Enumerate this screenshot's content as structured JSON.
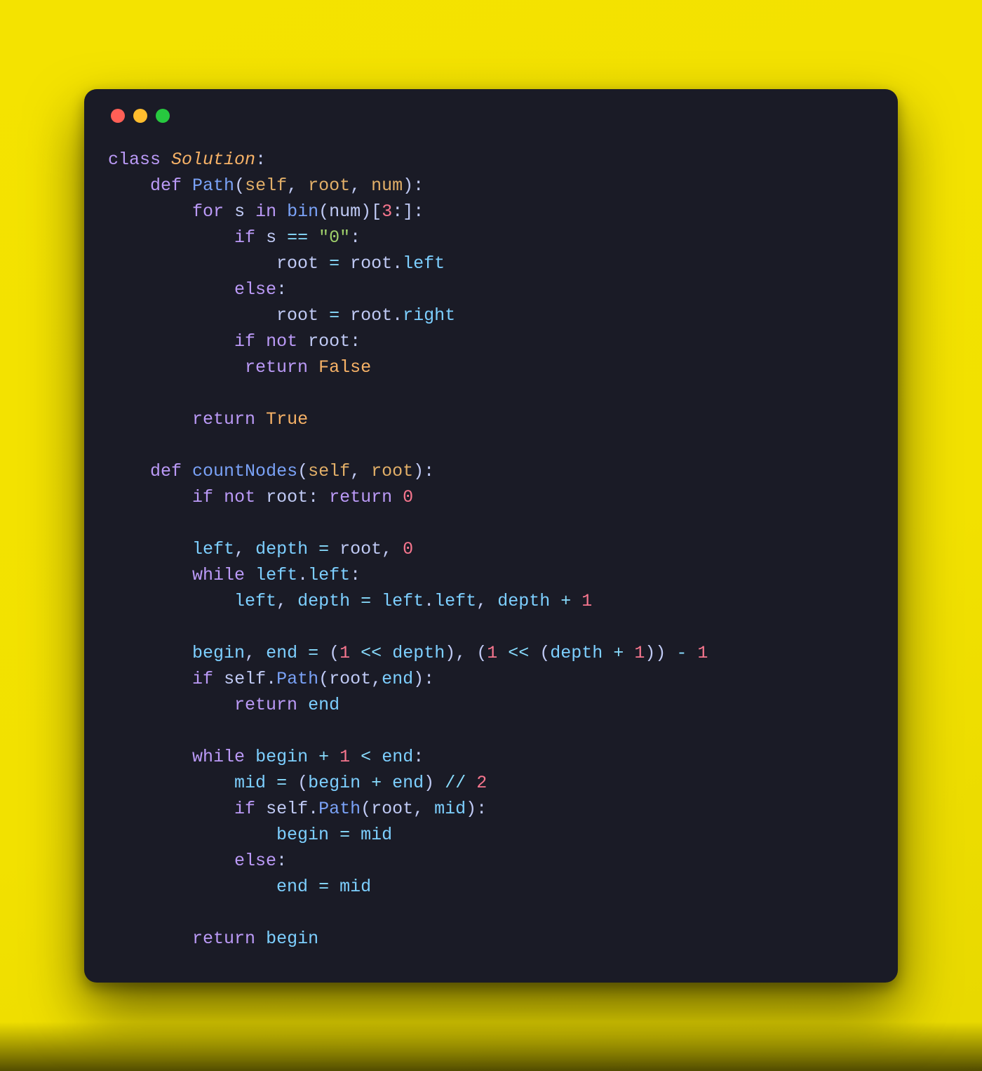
{
  "language": "python",
  "theme": {
    "background": "#1a1b26",
    "frame_background": "#f4e300",
    "keyword": "#bb9af7",
    "classname": "#f7b267",
    "function": "#7aa2f7",
    "parameter": "#e2af68",
    "identifier": "#c0caf5",
    "property": "#7dcfff",
    "number": "#f7768e",
    "string": "#9ece6a",
    "boolean": "#f7b267",
    "operator": "#89ddff"
  },
  "traffic_lights": [
    "red",
    "yellow",
    "green"
  ],
  "code_lines": [
    [
      [
        "kw",
        "class"
      ],
      [
        "pun",
        " "
      ],
      [
        "cls",
        "Solution"
      ],
      [
        "pun",
        ":"
      ]
    ],
    [
      [
        "pun",
        "    "
      ],
      [
        "kw",
        "def"
      ],
      [
        "pun",
        " "
      ],
      [
        "fn",
        "Path"
      ],
      [
        "pun",
        "("
      ],
      [
        "arg",
        "self"
      ],
      [
        "pun",
        ", "
      ],
      [
        "arg",
        "root"
      ],
      [
        "pun",
        ", "
      ],
      [
        "arg",
        "num"
      ],
      [
        "pun",
        "):"
      ]
    ],
    [
      [
        "pun",
        "        "
      ],
      [
        "kw",
        "for"
      ],
      [
        "pun",
        " "
      ],
      [
        "var",
        "s"
      ],
      [
        "pun",
        " "
      ],
      [
        "kw",
        "in"
      ],
      [
        "pun",
        " "
      ],
      [
        "fn",
        "bin"
      ],
      [
        "pun",
        "("
      ],
      [
        "var",
        "num"
      ],
      [
        "pun",
        ")["
      ],
      [
        "num",
        "3"
      ],
      [
        "pun",
        ":]:"
      ]
    ],
    [
      [
        "pun",
        "            "
      ],
      [
        "kw",
        "if"
      ],
      [
        "pun",
        " "
      ],
      [
        "var",
        "s"
      ],
      [
        "pun",
        " "
      ],
      [
        "op",
        "=="
      ],
      [
        "pun",
        " "
      ],
      [
        "str",
        "\"0\""
      ],
      [
        "pun",
        ":"
      ]
    ],
    [
      [
        "pun",
        "                "
      ],
      [
        "var",
        "root"
      ],
      [
        "pun",
        " "
      ],
      [
        "op",
        "="
      ],
      [
        "pun",
        " "
      ],
      [
        "var",
        "root"
      ],
      [
        "pun",
        "."
      ],
      [
        "prop",
        "left"
      ]
    ],
    [
      [
        "pun",
        "            "
      ],
      [
        "kw",
        "else"
      ],
      [
        "pun",
        ":"
      ]
    ],
    [
      [
        "pun",
        "                "
      ],
      [
        "var",
        "root"
      ],
      [
        "pun",
        " "
      ],
      [
        "op",
        "="
      ],
      [
        "pun",
        " "
      ],
      [
        "var",
        "root"
      ],
      [
        "pun",
        "."
      ],
      [
        "prop",
        "right"
      ]
    ],
    [
      [
        "pun",
        "            "
      ],
      [
        "kw",
        "if"
      ],
      [
        "pun",
        " "
      ],
      [
        "kw",
        "not"
      ],
      [
        "pun",
        " "
      ],
      [
        "var",
        "root"
      ],
      [
        "pun",
        ":"
      ]
    ],
    [
      [
        "pun",
        "             "
      ],
      [
        "kw",
        "return"
      ],
      [
        "pun",
        " "
      ],
      [
        "boolv",
        "False"
      ]
    ],
    [],
    [
      [
        "pun",
        "        "
      ],
      [
        "kw",
        "return"
      ],
      [
        "pun",
        " "
      ],
      [
        "boolv",
        "True"
      ]
    ],
    [],
    [
      [
        "pun",
        "    "
      ],
      [
        "kw",
        "def"
      ],
      [
        "pun",
        " "
      ],
      [
        "fn",
        "countNodes"
      ],
      [
        "pun",
        "("
      ],
      [
        "arg",
        "self"
      ],
      [
        "pun",
        ", "
      ],
      [
        "arg",
        "root"
      ],
      [
        "pun",
        "):"
      ]
    ],
    [
      [
        "pun",
        "        "
      ],
      [
        "kw",
        "if"
      ],
      [
        "pun",
        " "
      ],
      [
        "kw",
        "not"
      ],
      [
        "pun",
        " "
      ],
      [
        "var",
        "root"
      ],
      [
        "pun",
        ": "
      ],
      [
        "kw",
        "return"
      ],
      [
        "pun",
        " "
      ],
      [
        "num",
        "0"
      ]
    ],
    [],
    [
      [
        "pun",
        "        "
      ],
      [
        "prop",
        "left"
      ],
      [
        "pun",
        ", "
      ],
      [
        "prop",
        "depth"
      ],
      [
        "pun",
        " "
      ],
      [
        "op",
        "="
      ],
      [
        "pun",
        " "
      ],
      [
        "var",
        "root"
      ],
      [
        "pun",
        ", "
      ],
      [
        "num",
        "0"
      ]
    ],
    [
      [
        "pun",
        "        "
      ],
      [
        "kw",
        "while"
      ],
      [
        "pun",
        " "
      ],
      [
        "prop",
        "left"
      ],
      [
        "pun",
        "."
      ],
      [
        "prop",
        "left"
      ],
      [
        "pun",
        ":"
      ]
    ],
    [
      [
        "pun",
        "            "
      ],
      [
        "prop",
        "left"
      ],
      [
        "pun",
        ", "
      ],
      [
        "prop",
        "depth"
      ],
      [
        "pun",
        " "
      ],
      [
        "op",
        "="
      ],
      [
        "pun",
        " "
      ],
      [
        "prop",
        "left"
      ],
      [
        "pun",
        "."
      ],
      [
        "prop",
        "left"
      ],
      [
        "pun",
        ", "
      ],
      [
        "prop",
        "depth"
      ],
      [
        "pun",
        " "
      ],
      [
        "op",
        "+"
      ],
      [
        "pun",
        " "
      ],
      [
        "num",
        "1"
      ]
    ],
    [],
    [
      [
        "pun",
        "        "
      ],
      [
        "prop",
        "begin"
      ],
      [
        "pun",
        ", "
      ],
      [
        "prop",
        "end"
      ],
      [
        "pun",
        " "
      ],
      [
        "op",
        "="
      ],
      [
        "pun",
        " ("
      ],
      [
        "num",
        "1"
      ],
      [
        "pun",
        " "
      ],
      [
        "op",
        "<<"
      ],
      [
        "pun",
        " "
      ],
      [
        "prop",
        "depth"
      ],
      [
        "pun",
        "), ("
      ],
      [
        "num",
        "1"
      ],
      [
        "pun",
        " "
      ],
      [
        "op",
        "<<"
      ],
      [
        "pun",
        " ("
      ],
      [
        "prop",
        "depth"
      ],
      [
        "pun",
        " "
      ],
      [
        "op",
        "+"
      ],
      [
        "pun",
        " "
      ],
      [
        "num",
        "1"
      ],
      [
        "pun",
        ")) "
      ],
      [
        "op",
        "-"
      ],
      [
        "pun",
        " "
      ],
      [
        "num",
        "1"
      ]
    ],
    [
      [
        "pun",
        "        "
      ],
      [
        "kw",
        "if"
      ],
      [
        "pun",
        " "
      ],
      [
        "var",
        "self"
      ],
      [
        "pun",
        "."
      ],
      [
        "fn",
        "Path"
      ],
      [
        "pun",
        "("
      ],
      [
        "var",
        "root"
      ],
      [
        "pun",
        ","
      ],
      [
        "prop",
        "end"
      ],
      [
        "pun",
        "):"
      ]
    ],
    [
      [
        "pun",
        "            "
      ],
      [
        "kw",
        "return"
      ],
      [
        "pun",
        " "
      ],
      [
        "prop",
        "end"
      ]
    ],
    [],
    [
      [
        "pun",
        "        "
      ],
      [
        "kw",
        "while"
      ],
      [
        "pun",
        " "
      ],
      [
        "prop",
        "begin"
      ],
      [
        "pun",
        " "
      ],
      [
        "op",
        "+"
      ],
      [
        "pun",
        " "
      ],
      [
        "num",
        "1"
      ],
      [
        "pun",
        " "
      ],
      [
        "op",
        "<"
      ],
      [
        "pun",
        " "
      ],
      [
        "prop",
        "end"
      ],
      [
        "pun",
        ":"
      ]
    ],
    [
      [
        "pun",
        "            "
      ],
      [
        "prop",
        "mid"
      ],
      [
        "pun",
        " "
      ],
      [
        "op",
        "="
      ],
      [
        "pun",
        " ("
      ],
      [
        "prop",
        "begin"
      ],
      [
        "pun",
        " "
      ],
      [
        "op",
        "+"
      ],
      [
        "pun",
        " "
      ],
      [
        "prop",
        "end"
      ],
      [
        "pun",
        ") "
      ],
      [
        "op",
        "//"
      ],
      [
        "pun",
        " "
      ],
      [
        "num",
        "2"
      ]
    ],
    [
      [
        "pun",
        "            "
      ],
      [
        "kw",
        "if"
      ],
      [
        "pun",
        " "
      ],
      [
        "var",
        "self"
      ],
      [
        "pun",
        "."
      ],
      [
        "fn",
        "Path"
      ],
      [
        "pun",
        "("
      ],
      [
        "var",
        "root"
      ],
      [
        "pun",
        ", "
      ],
      [
        "prop",
        "mid"
      ],
      [
        "pun",
        "):"
      ]
    ],
    [
      [
        "pun",
        "                "
      ],
      [
        "prop",
        "begin"
      ],
      [
        "pun",
        " "
      ],
      [
        "op",
        "="
      ],
      [
        "pun",
        " "
      ],
      [
        "prop",
        "mid"
      ]
    ],
    [
      [
        "pun",
        "            "
      ],
      [
        "kw",
        "else"
      ],
      [
        "pun",
        ":"
      ]
    ],
    [
      [
        "pun",
        "                "
      ],
      [
        "prop",
        "end"
      ],
      [
        "pun",
        " "
      ],
      [
        "op",
        "="
      ],
      [
        "pun",
        " "
      ],
      [
        "prop",
        "mid"
      ]
    ],
    [],
    [
      [
        "pun",
        "        "
      ],
      [
        "kw",
        "return"
      ],
      [
        "pun",
        " "
      ],
      [
        "prop",
        "begin"
      ]
    ]
  ],
  "code_plain": "class Solution:\n    def Path(self, root, num):\n        for s in bin(num)[3:]:\n            if s == \"0\":\n                root = root.left\n            else:\n                root = root.right\n            if not root:\n             return False\n\n        return True\n\n    def countNodes(self, root):\n        if not root: return 0\n\n        left, depth = root, 0\n        while left.left:\n            left, depth = left.left, depth + 1\n\n        begin, end = (1 << depth), (1 << (depth + 1)) - 1\n        if self.Path(root,end):\n            return end\n\n        while begin + 1 < end:\n            mid = (begin + end) // 2\n            if self.Path(root, mid):\n                begin = mid\n            else:\n                end = mid\n\n        return begin"
}
